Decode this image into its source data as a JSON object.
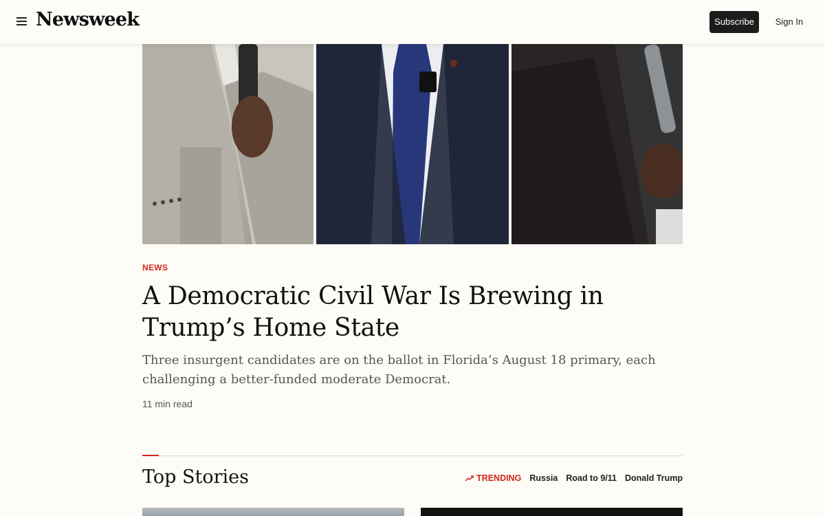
{
  "header": {
    "logo": "Newsweek",
    "subscribe_label": "Subscribe",
    "signin_label": "Sign In"
  },
  "lead": {
    "kicker": "NEWS",
    "headline": "A Democratic Civil War Is Brewing in Trump’s Home State",
    "dek": "Three insurgent candidates are on the ballot in Florida’s August 18 primary, each challenging a better-funded moderate Democrat.",
    "read_time": "11 min read"
  },
  "top_stories": {
    "title": "Top Stories",
    "trending_label": "TRENDING",
    "trending_links": [
      "Russia",
      "Road to 9/11",
      "Donald Trump"
    ]
  },
  "colors": {
    "accent": "#d0261c",
    "background": "#fdfcf6",
    "button": "#1c1c1c"
  }
}
